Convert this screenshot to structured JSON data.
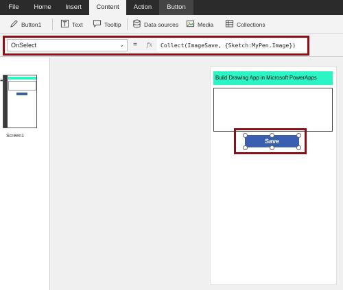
{
  "menu": {
    "file": "File",
    "home": "Home",
    "insert": "Insert",
    "content": "Content",
    "action": "Action",
    "button": "Button"
  },
  "ribbon": {
    "control_name": "Button1",
    "text": "Text",
    "tooltip": "Tooltip",
    "data_sources": "Data sources",
    "media": "Media",
    "collections": "Collections"
  },
  "formula_bar": {
    "property": "OnSelect",
    "equals": "=",
    "fx": "fx",
    "formula": "Collect(ImageSave, {Sketch:MyPen.Image})"
  },
  "screens": {
    "screen1_label": "Screen1",
    "more": "•••"
  },
  "canvas": {
    "title": "Build Drawing App in Microsoft PowerApps",
    "save_button": "Save"
  },
  "colors": {
    "menubar": "#2b2b2b",
    "highlight_border": "#8b0f14",
    "title_bg": "#2bf5c5",
    "save_button": "#3a5fb0"
  }
}
